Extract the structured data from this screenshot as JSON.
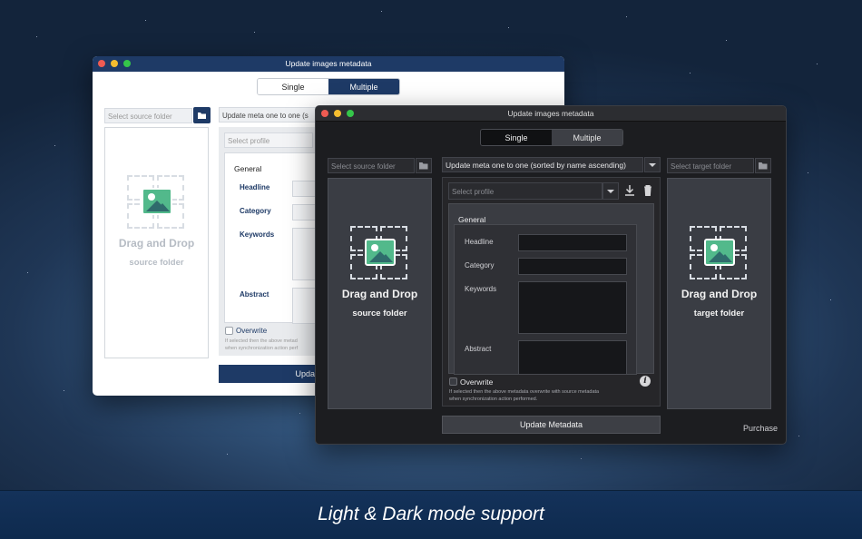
{
  "caption": "Light & Dark mode support",
  "light_window": {
    "title": "Update images metadata",
    "mode_single": "Single",
    "mode_multiple": "Multiple",
    "source_placeholder": "Select source folder",
    "meta_mode_value": "Update meta one to one (s",
    "profile_placeholder": "Select profile",
    "section": "General",
    "labels": {
      "headline": "Headline",
      "category": "Category",
      "keywords": "Keywords",
      "abstract": "Abstract"
    },
    "overwrite_label": "Overwrite",
    "hint_line1": "If selected then the above metad",
    "hint_line2": "when synchronization action perf",
    "drop_title": "Drag and Drop",
    "drop_sub": "source folder",
    "update_btn": "Upda"
  },
  "dark_window": {
    "title": "Update images metadata",
    "mode_single": "Single",
    "mode_multiple": "Multiple",
    "source_placeholder": "Select source folder",
    "meta_mode_value": "Update meta one to one (sorted by name ascending)",
    "target_placeholder": "Select target folder",
    "profile_placeholder": "Select profile",
    "section": "General",
    "labels": {
      "headline": "Headline",
      "category": "Category",
      "keywords": "Keywords",
      "abstract": "Abstract"
    },
    "overwrite_label": "Overwrite",
    "hint_line1": "If selected then the above metadata overwrite with source metadata",
    "hint_line2": "when synchronization action performed.",
    "drop_source_title": "Drag and Drop",
    "drop_source_sub": "source folder",
    "drop_target_title": "Drag and Drop",
    "drop_target_sub": "target folder",
    "update_btn": "Update Metadata",
    "purchase": "Purchase"
  },
  "colors": {
    "light_accent": "#1e3a66",
    "dark_bg": "#1c1d20",
    "placeholder_green": "#52b98b"
  },
  "icons": [
    "folder-icon",
    "chevron-down-icon",
    "download-icon",
    "trash-icon",
    "info-icon",
    "image-icon"
  ]
}
